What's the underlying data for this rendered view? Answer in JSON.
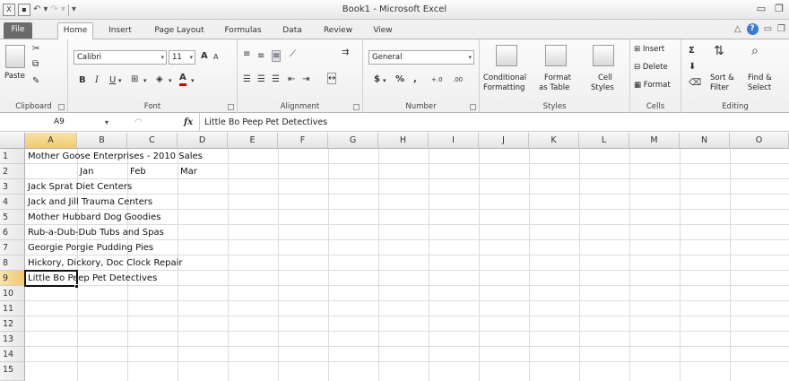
{
  "window": {
    "title": "Book1  -  Microsoft Excel"
  },
  "tabs": [
    "File",
    "Home",
    "Insert",
    "Page Layout",
    "Formulas",
    "Data",
    "Review",
    "View"
  ],
  "ribbon": {
    "clipboard": {
      "paste": "Paste",
      "label": "Clipboard"
    },
    "font": {
      "name": "Calibri",
      "size": "11",
      "label": "Font",
      "bold": "B",
      "italic": "I",
      "underline": "U",
      "grow": "A",
      "shrink": "A"
    },
    "alignment": {
      "label": "Alignment"
    },
    "number": {
      "format": "General",
      "currency": "$",
      "percent": "%",
      "comma": ",",
      "label": "Number"
    },
    "styles": {
      "conditional": "Conditional",
      "conditional2": "Formatting",
      "format_table": "Format",
      "format_table2": "as Table",
      "cell_styles": "Cell",
      "cell_styles2": "Styles",
      "label": "Styles"
    },
    "cells": {
      "insert": "Insert",
      "delete": "Delete",
      "format": "Format",
      "label": "Cells"
    },
    "editing": {
      "sum": "Σ",
      "sort": "Sort &",
      "sort2": "Filter",
      "find": "Find &",
      "find2": "Select",
      "label": "Editing"
    }
  },
  "formula_bar": {
    "name_box": "A9",
    "fx": "fx",
    "content": "Little Bo Peep Pet Detectives"
  },
  "sheet": {
    "columns": [
      "A",
      "B",
      "C",
      "D",
      "E",
      "F",
      "G",
      "H",
      "I",
      "J",
      "K",
      "L",
      "M",
      "N",
      "O"
    ],
    "rows": [
      "1",
      "2",
      "3",
      "4",
      "5",
      "6",
      "7",
      "8",
      "9",
      "10",
      "11",
      "12",
      "13",
      "14",
      "15"
    ],
    "selected_column": "A",
    "selected_row": "9",
    "cells": {
      "a1": "Mother Goose Enterprises - 2010 Sales",
      "b2": "Jan",
      "c2": "Feb",
      "d2": "Mar",
      "a3": "Jack Sprat Diet Centers",
      "a4": "Jack and Jill Trauma Centers",
      "a5": "Mother Hubbard Dog Goodies",
      "a6": "Rub-a-Dub-Dub Tubs and Spas",
      "a7": "Georgie Porgie Pudding Pies",
      "a8": "Hickory, Dickory, Doc Clock Repair",
      "a9": "Little Bo Peep Pet Detectives"
    }
  }
}
